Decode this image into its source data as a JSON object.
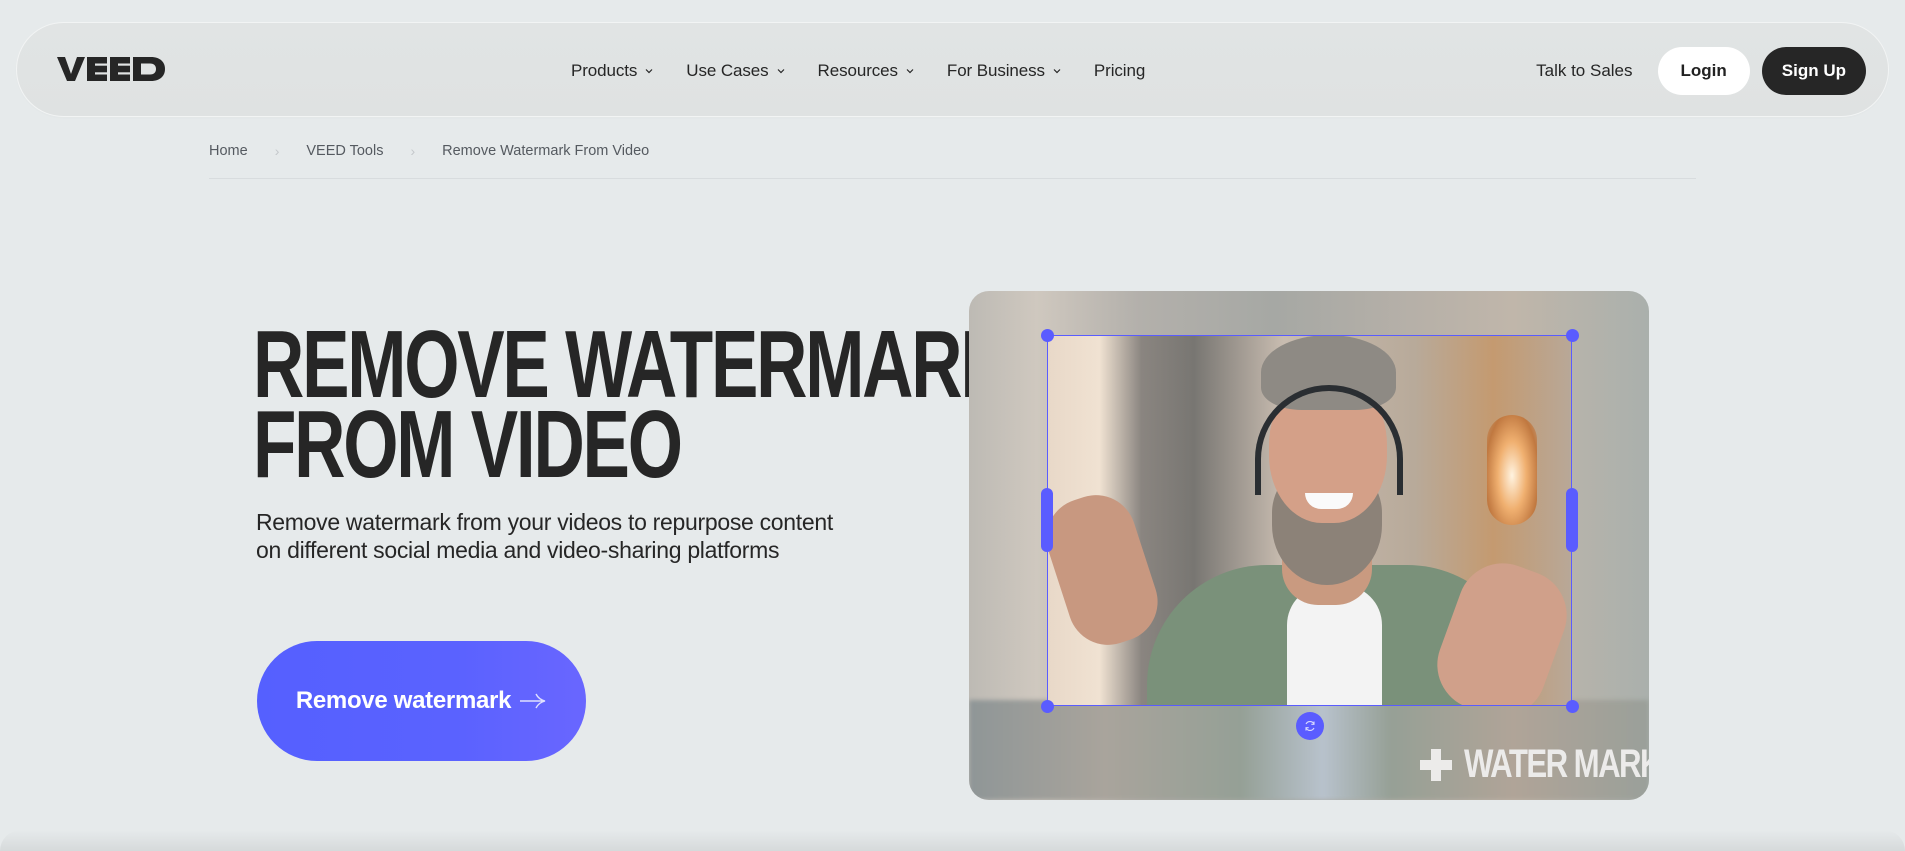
{
  "brand": {
    "logo_text": "VEED",
    "accent_color": "#5a5cff",
    "dark_color": "#262626"
  },
  "nav": {
    "items": [
      {
        "label": "Products",
        "has_dropdown": true,
        "icon": "chevron-down-icon"
      },
      {
        "label": "Use Cases",
        "has_dropdown": true,
        "icon": "chevron-down-icon"
      },
      {
        "label": "Resources",
        "has_dropdown": true,
        "icon": "chevron-down-icon"
      },
      {
        "label": "For Business",
        "has_dropdown": true,
        "icon": "chevron-down-icon"
      },
      {
        "label": "Pricing",
        "has_dropdown": false
      }
    ],
    "talk_to_sales": "Talk to Sales",
    "login": "Login",
    "signup": "Sign Up"
  },
  "breadcrumb": {
    "items": [
      "Home",
      "VEED Tools",
      "Remove Watermark From Video"
    ],
    "separator": "›"
  },
  "hero": {
    "title_line1": "REMOVE WATERMARK",
    "title_line2": "FROM VIDEO",
    "subtitle": "Remove watermark from your videos to repurpose content on different social media and video-sharing platforms",
    "cta_label": "Remove watermark",
    "cta_icon": "arrow-right-icon"
  },
  "media": {
    "watermark_text": "WATER MARK",
    "watermark_icon": "plus-icon",
    "rotate_icon": "rotate-icon"
  }
}
